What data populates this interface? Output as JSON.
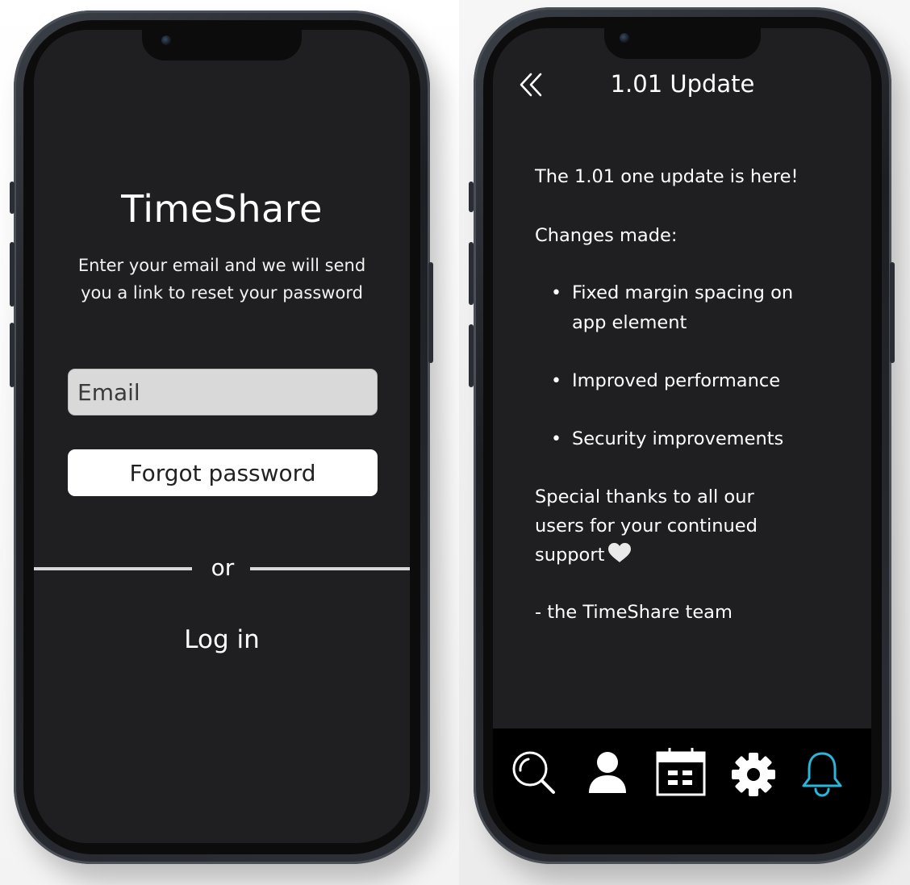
{
  "login_screen": {
    "app_name": "TimeShare",
    "instruction": "Enter your email and we will send you a link to reset your password",
    "email_placeholder": "Email",
    "forgot_button_label": "Forgot password",
    "or_label": "or",
    "login_link_label": "Log in"
  },
  "update_screen": {
    "title": "1.01 Update",
    "intro": "The 1.01 one update is here!",
    "changes_heading": "Changes made:",
    "changes": [
      {
        "line1": "Fixed margin spacing on",
        "line2": "app element"
      },
      {
        "line1": "Improved performance"
      },
      {
        "line1": "Security improvements"
      }
    ],
    "thanks_line1": "Special thanks to all our",
    "thanks_line2": "users for your continued",
    "thanks_line3": "support",
    "signoff": "- the TimeShare team",
    "bullet_char": "•"
  },
  "nav": {
    "icons": [
      "search-icon",
      "profile-icon",
      "calendar-icon",
      "settings-icon",
      "notifications-icon"
    ],
    "active": "notifications-icon",
    "active_color": "#29b6d8",
    "icon_color": "#ffffff"
  },
  "colors": {
    "screen_bg": "#1f1f21",
    "input_bg": "#d9d9d9",
    "button_bg": "#ffffff"
  }
}
